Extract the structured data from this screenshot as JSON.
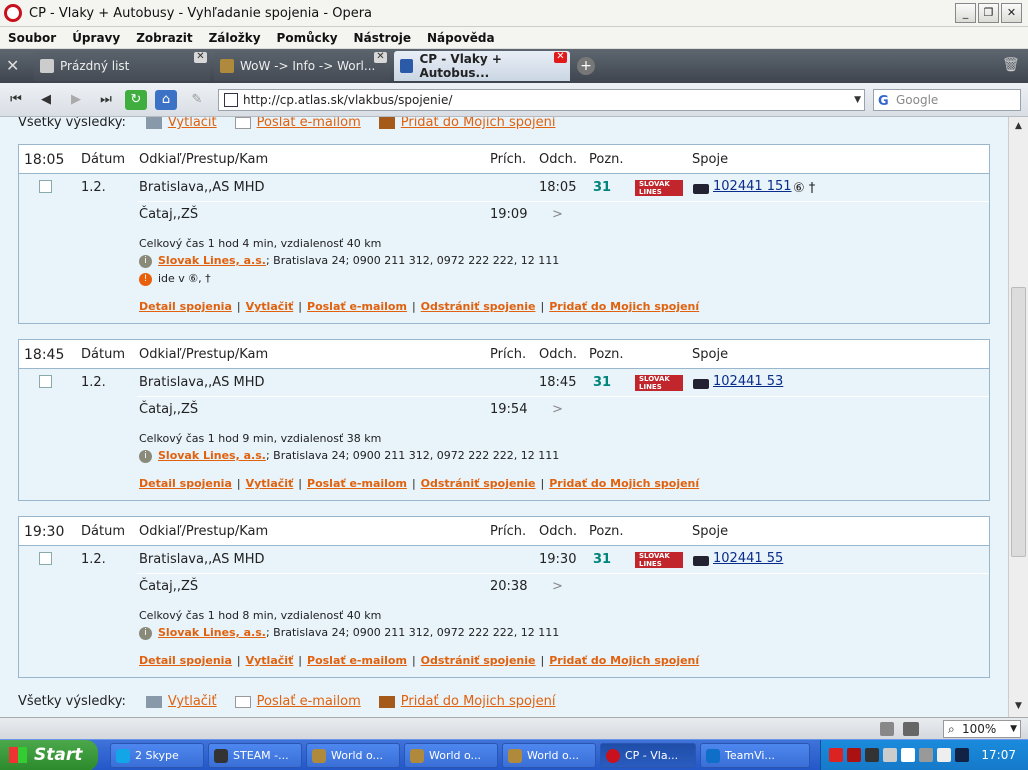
{
  "window": {
    "title": "CP - Vlaky + Autobusy - Vyhľadanie spojenia - Opera"
  },
  "menu": [
    "Soubor",
    "Úpravy",
    "Zobrazit",
    "Záložky",
    "Pomůcky",
    "Nástroje",
    "Nápověda"
  ],
  "tabs": [
    {
      "label": "Prázdný list"
    },
    {
      "label": "WoW -> Info -> Worl..."
    },
    {
      "label": "CP - Vlaky + Autobus..."
    }
  ],
  "address": {
    "url": "http://cp.atlas.sk/vlakbus/spojenie/",
    "search_placeholder": "Google"
  },
  "toolbar": {
    "all_results": "Všetky výsledky:",
    "print": "Vytlačiť",
    "email": "Poslať e-mailom",
    "add": "Pridať do Mojich spojení"
  },
  "headers": {
    "date": "Dátum",
    "route": "Odkiaľ/Prestup/Kam",
    "arr": "Prích.",
    "dep": "Odch.",
    "note": "Pozn.",
    "conn": "Spoje"
  },
  "results": [
    {
      "time": "18:05",
      "date": "1.2.",
      "from": "Bratislava,,AS MHD",
      "dep": "18:05",
      "pozn": "31",
      "conn": "102441 151",
      "conn_marks": "⑥ †",
      "to": "Čataj,,ZŠ",
      "arr": "19:09",
      "summary": "Celkový čas 1 hod 4 min, vzdialenosť 40 km",
      "carrier": "Slovak Lines, a.s.",
      "carrier_info": "; Bratislava 24; 0900 211 312, 0972 222 222, 12 111",
      "runs": "ide v ⑥, †"
    },
    {
      "time": "18:45",
      "date": "1.2.",
      "from": "Bratislava,,AS MHD",
      "dep": "18:45",
      "pozn": "31",
      "conn": "102441 53",
      "conn_marks": "",
      "to": "Čataj,,ZŠ",
      "arr": "19:54",
      "summary": "Celkový čas 1 hod 9 min, vzdialenosť 38 km",
      "carrier": "Slovak Lines, a.s.",
      "carrier_info": "; Bratislava 24; 0900 211 312, 0972 222 222, 12 111",
      "runs": ""
    },
    {
      "time": "19:30",
      "date": "1.2.",
      "from": "Bratislava,,AS MHD",
      "dep": "19:30",
      "pozn": "31",
      "conn": "102441 55",
      "conn_marks": "",
      "to": "Čataj,,ZŠ",
      "arr": "20:38",
      "summary": "Celkový čas 1 hod 8 min, vzdialenosť 40 km",
      "carrier": "Slovak Lines, a.s.",
      "carrier_info": "; Bratislava 24; 0900 211 312, 0972 222 222, 12 111",
      "runs": ""
    }
  ],
  "row_links": [
    "Detail spojenia",
    "Vytlačiť",
    "Poslať e-mailom",
    "Odstrániť spojenie",
    "Pridať do Mojich spojení"
  ],
  "logo_text": "SLOVAK LINES",
  "status": {
    "zoom": "100%"
  },
  "taskbar": {
    "start": "Start",
    "items": [
      "2 Skype",
      "STEAM -...",
      "World o...",
      "World o...",
      "World o...",
      "CP - Vla...",
      "TeamVi..."
    ],
    "clock": "17:07"
  }
}
